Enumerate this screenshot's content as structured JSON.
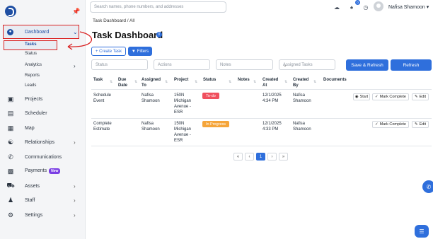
{
  "sidebar": {
    "items": [
      {
        "label": "Dashboard",
        "icon": "dashboard-icon"
      },
      {
        "label": "Projects",
        "icon": "briefcase-icon"
      },
      {
        "label": "Scheduler",
        "icon": "calendar-icon"
      },
      {
        "label": "Map",
        "icon": "map-icon"
      },
      {
        "label": "Relationships",
        "icon": "handshake-icon"
      },
      {
        "label": "Communications",
        "icon": "phone-icon"
      },
      {
        "label": "Payments",
        "icon": "wallet-icon",
        "badge": "New"
      },
      {
        "label": "Assets",
        "icon": "truck-icon"
      },
      {
        "label": "Staff",
        "icon": "people-icon"
      },
      {
        "label": "Settings",
        "icon": "gear-icon"
      }
    ],
    "dashboard_sub": [
      "Tasks",
      "Status",
      "Analytics",
      "Reports",
      "Leads"
    ]
  },
  "topbar": {
    "search_placeholder": "Search names, phone numbers, and addresses",
    "notification_count": "0",
    "user_name": "Nafisa Shamoon"
  },
  "main": {
    "breadcrumb": "Task Dashboard / All",
    "title": "Task Dashboard",
    "create_task_label": "+ Create Task",
    "filters_label": "Filters",
    "filter_fields": {
      "status": "Status",
      "actions": "Actions",
      "notes": "Notes",
      "assigned_tasks": "Assigned Tasks"
    },
    "save_refresh_label": "Save & Refresh",
    "refresh_label": "Refresh"
  },
  "table": {
    "headers": [
      "Task",
      "Due Date",
      "Assigned To",
      "Project",
      "Status",
      "Notes",
      "Created At",
      "Created By",
      "Documents"
    ],
    "rows": [
      {
        "task": "Schedule Event",
        "due_date": "",
        "assigned_to": "Nafisa Shamoon",
        "project": "150N Michigan Avenue - ESR",
        "status": "To-do",
        "notes": "",
        "created_at": "12/1/2025 4:34 PM",
        "created_by": "Nafisa Shamoon",
        "actions": [
          "Start",
          "Mark Complete",
          "Edit"
        ]
      },
      {
        "task": "Complete Estimate",
        "due_date": "",
        "assigned_to": "Nafisa Shamoon",
        "project": "150N Michigan Avenue - ESR",
        "status": "In Progress",
        "notes": "",
        "created_at": "12/1/2025 4:33 PM",
        "created_by": "Nafisa Shamoon",
        "actions": [
          "Mark Complete",
          "Edit"
        ]
      }
    ]
  },
  "pagination": {
    "first": "«",
    "prev": "‹",
    "current": "1",
    "next": "›",
    "last": "»"
  },
  "colors": {
    "accent": "#2f6fdc",
    "todo": "#f0505e",
    "in_progress": "#f5a53a",
    "highlight": "#d92020"
  }
}
